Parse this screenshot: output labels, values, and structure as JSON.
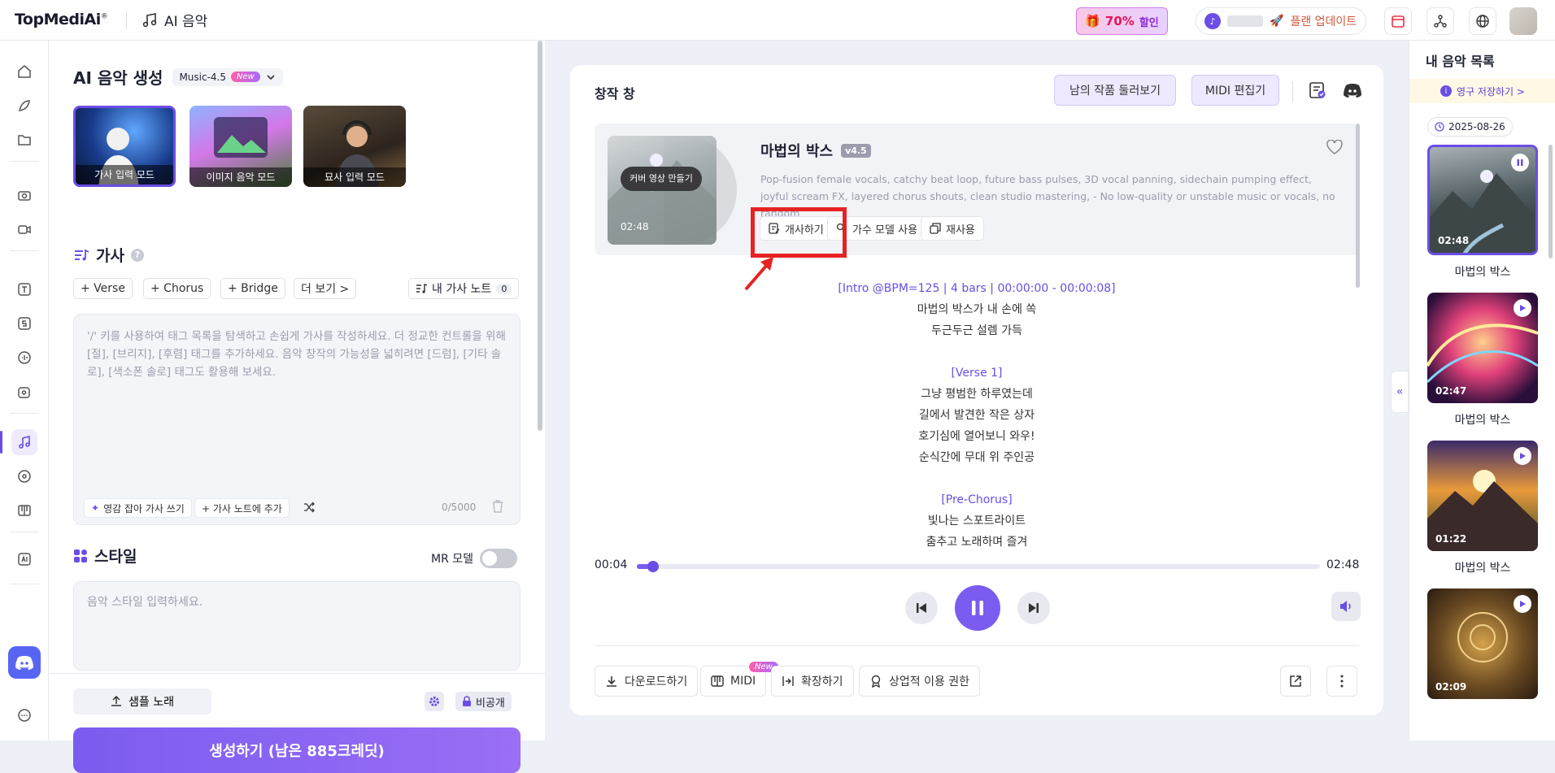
{
  "topbar": {
    "logo": "TopMediAi",
    "logo_reg": "®",
    "app_title": "AI 음악",
    "promo_pct": "70%",
    "promo_label": "할인",
    "upgrade": "플랜 업데이트"
  },
  "left": {
    "title": "AI 음악 생성",
    "model": "Music-4.5",
    "model_badge": "New",
    "modes": [
      "가사 입력 모드",
      "이미지 음악 모드",
      "묘사 입력 모드"
    ],
    "lyrics_title": "가사",
    "tags": [
      "+ Verse",
      "+ Chorus",
      "+ Bridge",
      "더 보기 >"
    ],
    "my_notes": "내 가사 노트",
    "my_notes_count": "0",
    "lyrics_placeholder": "'/' 키를 사용하여 태그 목록을 탐색하고 손쉽게 가사를 작성하세요. 더 정교한 컨트롤을 위해 [절], [브리지], [후렴] 태그를 추가하세요. 음악 창작의 가능성을 넓히려면 [드럼], [기타 솔로], [색소폰 솔로] 태그도 활용해 보세요.",
    "inspire": "영감 잡아 가사 쓰기",
    "add_note": "+ 가사 노트에 추가",
    "counter": "0/5000",
    "style_title": "스타일",
    "mr_model": "MR 모델",
    "style_placeholder": "음악 스타일 입력하세요.",
    "sample": "샘플 노래",
    "private": "비공개",
    "generate": "생성하기 (남은 885크레딧)"
  },
  "main": {
    "title": "창작 창",
    "browse": "남의 작품 둘러보기",
    "midi_edit": "MIDI 편집기",
    "song": {
      "title": "마법의 박스",
      "version": "v4.5",
      "cover_btn": "커버 영상 만들기",
      "cover_time": "02:48",
      "desc": "Pop-fusion female vocals, catchy beat loop, future bass pulses, 3D vocal panning, sidechain pumping effect, joyful scream FX, layered chorus shouts, clean studio mastering, - No low-quality or unstable music or vocals, no random",
      "actions": [
        "개사하기",
        "가수 모델 사용",
        "재사용"
      ]
    },
    "lyrics": [
      {
        "type": "section",
        "text": "[Intro @BPM=125 | 4 bars | 00:00:00 - 00:00:08]"
      },
      {
        "type": "line",
        "text": "마법의 박스가 내 손에 쏙"
      },
      {
        "type": "line",
        "text": "두근두근 설렘 가득"
      },
      {
        "type": "gap",
        "text": ""
      },
      {
        "type": "section",
        "text": "[Verse 1]"
      },
      {
        "type": "line",
        "text": "그냥 평범한 하루였는데"
      },
      {
        "type": "line",
        "text": "길에서 발견한 작은 상자"
      },
      {
        "type": "line",
        "text": "호기심에 열어보니 와우!"
      },
      {
        "type": "line",
        "text": "순식간에 무대 위 주인공"
      },
      {
        "type": "gap",
        "text": ""
      },
      {
        "type": "section",
        "text": "[Pre-Chorus]"
      },
      {
        "type": "line",
        "text": "빛나는 스포트라이트"
      },
      {
        "type": "line",
        "text": "춤추고 노래하며 즐겨"
      }
    ],
    "player": {
      "current": "00:04",
      "total": "02:48",
      "progress": 0.024
    },
    "bottom": {
      "download": "다운로드하기",
      "midi": "MIDI",
      "midi_badge": "New",
      "extend": "확장하기",
      "commercial": "상업적 이용 권한"
    }
  },
  "right": {
    "title": "내 음악 목록",
    "permanent": "영구 저장하기 >",
    "date": "2025-08-26",
    "songs": [
      {
        "title": "마법의 박스",
        "duration": "02:48"
      },
      {
        "title": "마법의 박스",
        "duration": "02:47"
      },
      {
        "title": "마법의 박스",
        "duration": "01:22"
      },
      {
        "title": "",
        "duration": "02:09"
      }
    ]
  },
  "colors": {
    "accent": "#6b4de6",
    "highlight_box": "#e62222",
    "promo": "#e0155b"
  }
}
